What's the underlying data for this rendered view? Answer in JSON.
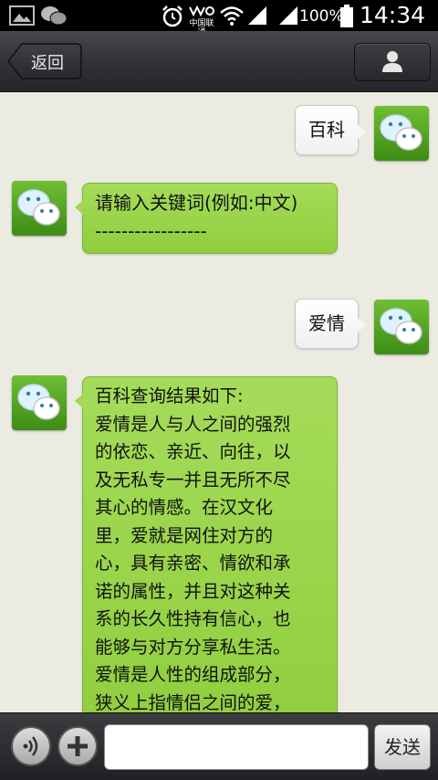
{
  "status_bar": {
    "time": "14:34",
    "battery_text": "100%",
    "carrier": "中国联通",
    "icons": [
      "image-icon",
      "wechat-notification-icon",
      "alarm-icon",
      "carrier-icon",
      "wifi-icon",
      "signal-icon",
      "signal-icon-2",
      "battery-icon"
    ]
  },
  "header": {
    "back_label": "返回",
    "profile_icon": "person-icon"
  },
  "messages": [
    {
      "side": "outgoing",
      "text": "百科"
    },
    {
      "side": "incoming",
      "text": "请输入关键词(例如:中文)\n-----------------"
    },
    {
      "side": "outgoing",
      "text": "爱情"
    },
    {
      "side": "incoming",
      "text": "百科查询结果如下:\n爱情是人与人之间的强烈\n的依恋、亲近、向往，以\n及无私专一并且无所不尽\n其心的情感。在汉文化\n里，爱就是网住对方的\n心，具有亲密、情欲和承\n诺的属性，并且对这种关\n系的长久性持有信心，也\n能够与对方分享私生活。\n爱情是人性的组成部分，\n狭义上指情侣之间的爱，\n广义上还包括朋友之间的"
    }
  ],
  "input_bar": {
    "voice_icon": "voice-icon",
    "plus_icon": "plus-icon",
    "input_value": "",
    "send_label": "发送"
  },
  "colors": {
    "status_bar": "#000000",
    "header": "#2e3034",
    "chat_background": "#ecebe1",
    "incoming_bubble": "#9ad54b",
    "outgoing_bubble": "#f6f6f6",
    "avatar_green": "#4fa522"
  }
}
